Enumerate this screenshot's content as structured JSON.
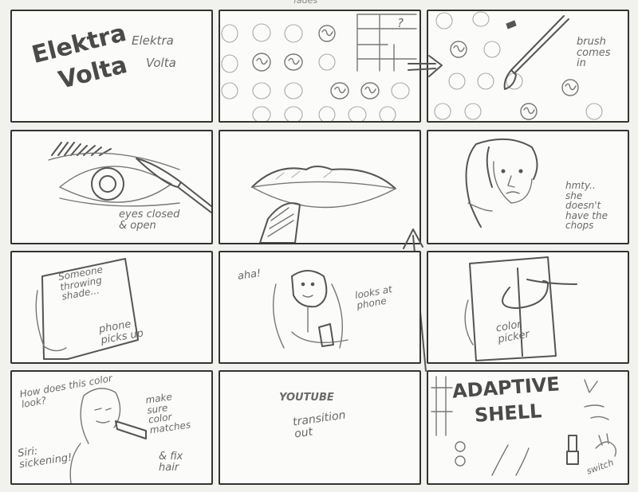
{
  "storyboard": {
    "header_note": "fades",
    "panels": [
      {
        "id": 1,
        "texts": {
          "logo_top": "Elektra",
          "logo_bottom": "Volta",
          "side_top": "Elektra",
          "side_bottom": "Volta"
        }
      },
      {
        "id": 2,
        "texts": {
          "question": "?"
        }
      },
      {
        "id": 3,
        "texts": {
          "note": "brush\ncomes\nin"
        }
      },
      {
        "id": 4,
        "texts": {
          "note": "eyes closed\n& open"
        }
      },
      {
        "id": 5,
        "texts": {}
      },
      {
        "id": 6,
        "texts": {
          "note": "hmty..\nshe\ndoesn't\nhave the\nchops"
        }
      },
      {
        "id": 7,
        "texts": {
          "phone_text": "Someone\nthrowing\nshade...",
          "note": "phone\npicks up"
        }
      },
      {
        "id": 8,
        "texts": {
          "exclaim": "aha!",
          "note": "looks at\nphone"
        }
      },
      {
        "id": 9,
        "texts": {
          "note": "color\npicker"
        }
      },
      {
        "id": 10,
        "texts": {
          "question": "How does this color\nlook?",
          "note_right": "make\nsure\ncolor\nmatches",
          "siri": "Siri:\nsickening!",
          "fix": "& fix\nhair"
        }
      },
      {
        "id": 11,
        "texts": {
          "title": "YOUTUBE",
          "note": "transition\nout"
        }
      },
      {
        "id": 12,
        "texts": {
          "title_top": "ADAPTIVE",
          "title_bottom": "SHELL",
          "note": "switch"
        }
      }
    ]
  },
  "colors": {
    "pencil": "#6a6a6a",
    "border": "#333333",
    "paper": "#fbfbf9"
  }
}
